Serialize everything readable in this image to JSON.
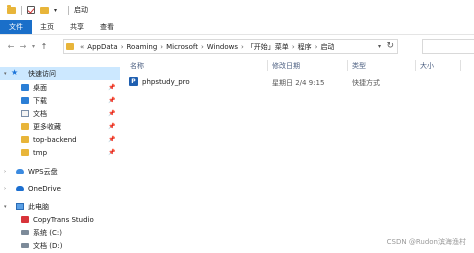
{
  "window": {
    "title": "启动"
  },
  "ribbon": {
    "tabs": [
      "文件",
      "主页",
      "共享",
      "查看"
    ]
  },
  "address": {
    "crumbs": [
      "AppData",
      "Roaming",
      "Microsoft",
      "Windows",
      "「开始」菜单",
      "程序",
      "启动"
    ]
  },
  "nav": {
    "quick_access": "快速访问",
    "items": [
      {
        "label": "桌面",
        "icon": "desktop-icon",
        "pinned": true
      },
      {
        "label": "下载",
        "icon": "download-icon",
        "pinned": true
      },
      {
        "label": "文档",
        "icon": "document-icon",
        "pinned": true
      },
      {
        "label": "更多收藏",
        "icon": "folder-icon",
        "pinned": true
      },
      {
        "label": "top-backend",
        "icon": "folder-icon",
        "pinned": true
      },
      {
        "label": "tmp",
        "icon": "folder-icon",
        "pinned": true
      }
    ],
    "wps_cloud": "WPS云盘",
    "onedrive": "OneDrive",
    "this_pc": "此电脑",
    "pc_items": [
      {
        "label": "CopyTrans Studio",
        "icon": "app-icon"
      },
      {
        "label": "系统 (C:)",
        "icon": "drive-icon"
      },
      {
        "label": "文档 (D:)",
        "icon": "drive-icon"
      }
    ]
  },
  "columns": {
    "name": "名称",
    "modified": "修改日期",
    "type": "类型",
    "size": "大小"
  },
  "files": [
    {
      "name": "phpstudy_pro",
      "modified": "星期日 2/4 9:15",
      "type": "快捷方式",
      "size": ""
    }
  ],
  "watermark": "CSDN @Rudon滨海渔村",
  "colors": {
    "accent": "#1a6fc9",
    "selection": "#cce8ff",
    "folder": "#e8b53a"
  }
}
